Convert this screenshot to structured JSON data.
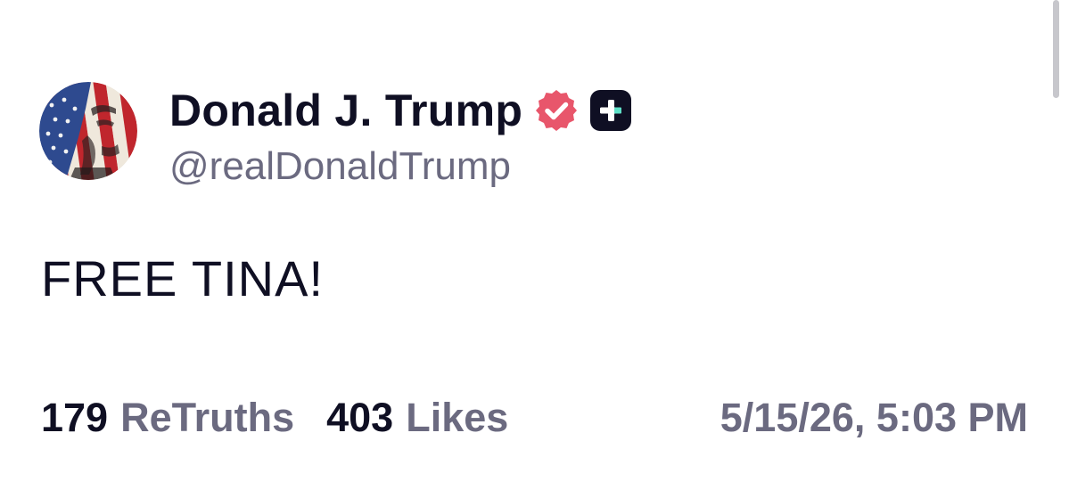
{
  "author": {
    "display_name": "Donald J. Trump",
    "handle": "@realDonaldTrump",
    "avatar_icon": "flag-portrait-avatar",
    "verified_icon": "verified-badge-icon",
    "membership_icon": "truth-plus-icon"
  },
  "post": {
    "text": "FREE TINA!"
  },
  "stats": {
    "retruths_count": "179",
    "retruths_label": "ReTruths",
    "likes_count": "403",
    "likes_label": "Likes"
  },
  "timestamp": "5/15/26, 5:03 PM",
  "colors": {
    "primary_text": "#0f0f23",
    "secondary_text": "#6b6a80",
    "verified_badge": "#e8566b",
    "plus_badge_bg": "#0f0f23",
    "plus_badge_accent": "#5de0c7"
  }
}
